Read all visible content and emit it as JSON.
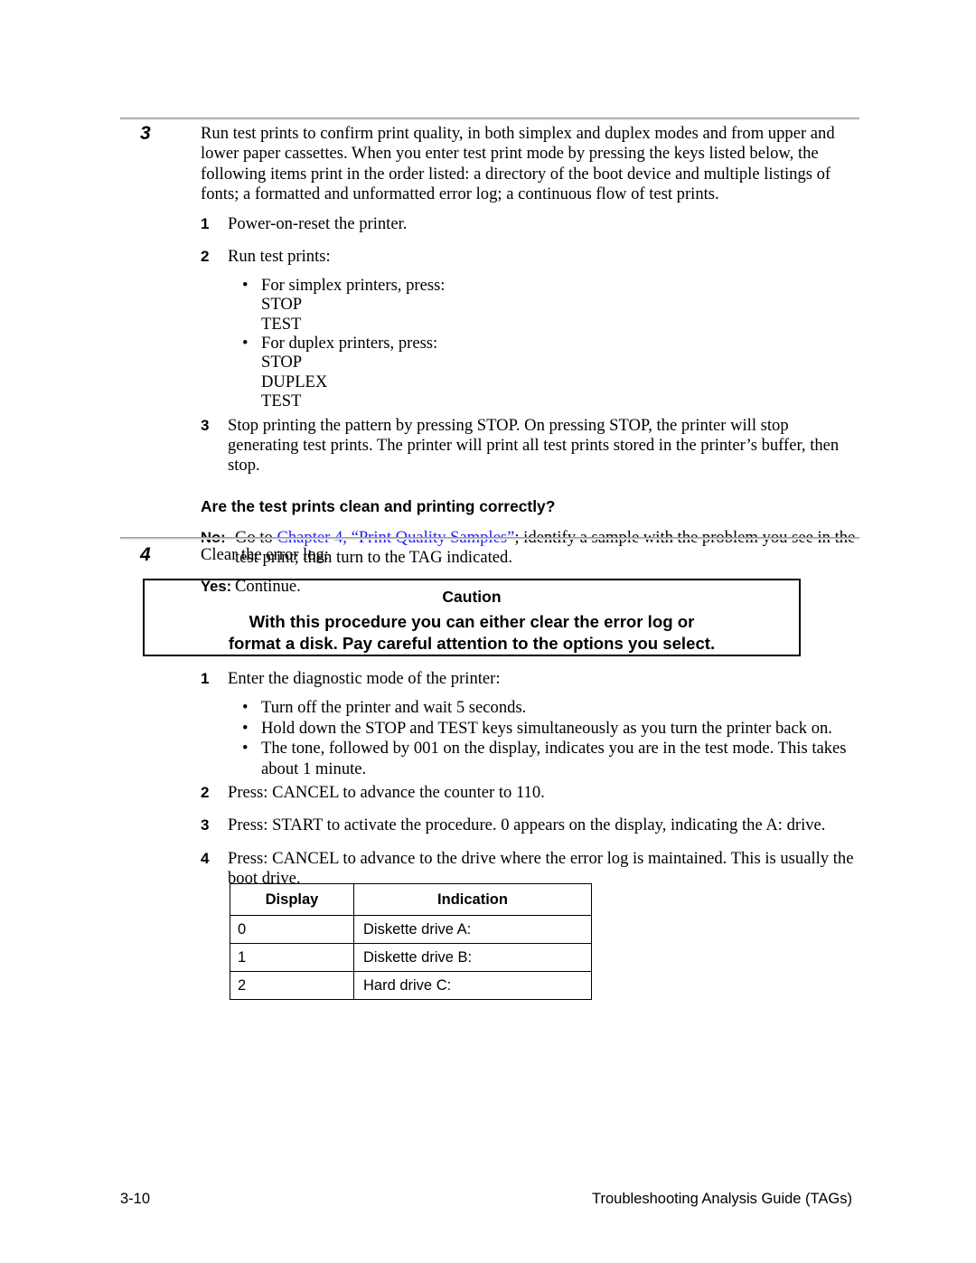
{
  "page": {
    "step3": {
      "number": "3",
      "intro": "Run test prints to confirm print quality, in both simplex and duplex modes and from upper and lower paper cassettes. When you enter test print mode by pressing the keys listed below, the following items print in the order listed: a directory of the boot device and multiple listings of fonts; a formatted and unformatted error log; a continuous flow of test prints.",
      "sub1_num": "1",
      "sub1_text": "Power-on-reset the printer.",
      "sub2_num": "2",
      "sub2_text": "Run test prints:",
      "bullet1_lead": "For simplex printers, press:",
      "bullet1_keys": [
        "STOP",
        "TEST"
      ],
      "bullet2_lead": "For duplex printers, press:",
      "bullet2_keys": [
        "STOP",
        "DUPLEX",
        "TEST"
      ],
      "sub3_num": "3",
      "sub3_text": "Stop printing the pattern by pressing STOP. On pressing STOP, the printer will stop generating test prints. The printer will print all test prints stored in the printer’s buffer, then stop.",
      "question": "Are the test prints clean and printing correctly?",
      "no_label": "No:",
      "no_text_before": "Go to ",
      "no_xref": "Chapter 4, “Print Quality Samples”",
      "no_text_after": "; identify a sample with the problem you see in the test print; then turn to the TAG indicated.",
      "yes_label": "Yes:",
      "yes_text": "Continue."
    },
    "step4": {
      "number": "4",
      "intro": "Clear the error log:",
      "caution": {
        "title": "Caution",
        "line1": "With this procedure you can either clear the error log or",
        "line2": "format a disk. Pay careful attention to the options you select."
      },
      "sub1_num": "1",
      "sub1_text": "Enter the diagnostic mode of the printer:",
      "bullets": [
        "Turn off the printer and wait 5 seconds.",
        "Hold down the STOP and TEST keys simultaneously as you turn the printer back on.",
        "The tone, followed by 001 on the display, indicates you are in the test mode. This takes about 1 minute."
      ],
      "sub2_num": "2",
      "sub2_text": "Press: CANCEL to advance the counter to 110.",
      "sub3_num": "3",
      "sub3_text": "Press: START to activate the procedure. 0 appears on the display, indicating the A: drive.",
      "sub4_num": "4",
      "sub4_text": "Press: CANCEL to advance to the drive where the error log is maintained. This is usually the boot drive."
    },
    "table": {
      "headers": [
        "Display",
        "Indication"
      ],
      "rows": [
        [
          "0",
          "Diskette drive A:"
        ],
        [
          "1",
          "Diskette drive B:"
        ],
        [
          "2",
          "Hard drive C:"
        ]
      ]
    },
    "footer": {
      "page_number": "3-10",
      "guide_title": "Troubleshooting Analysis Guide (TAGs)"
    },
    "bullet_glyph": "•",
    "colors": {
      "xref_blue": "#2222ee",
      "rule_gray": "#9a9a9a",
      "text_black": "#000000"
    }
  }
}
